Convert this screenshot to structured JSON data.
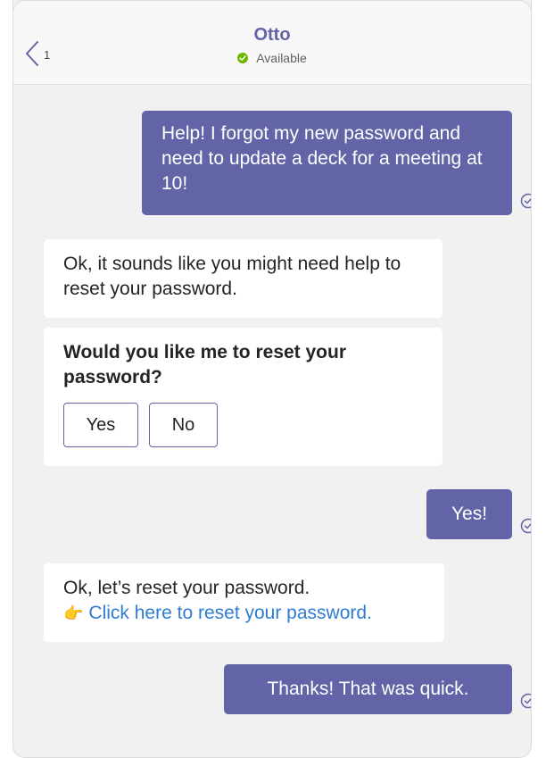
{
  "header": {
    "back_count": "1",
    "title": "Otto",
    "status": "Available"
  },
  "messages": {
    "m1": "Help! I forgot my new password and need to update a deck for a meeting at 10!",
    "m2": "Ok, it sounds like you might need help to reset your password.",
    "card": {
      "title": "Would you like me to reset your password?",
      "yes_label": "Yes",
      "no_label": "No"
    },
    "m3": "Yes!",
    "m4_text": "Ok, let’s reset your password.",
    "m4_link": "Click here to reset your password.",
    "m4_link_icon": "👉",
    "m5": "Thanks! That was quick."
  },
  "colors": {
    "accent": "#6264a7",
    "available": "#6bb700",
    "link": "#2e7cd1"
  },
  "icons": {
    "back": "chevron-left-icon",
    "status": "check-circle-icon",
    "read_receipt": "check-circle-outline-icon",
    "link": "pointing-hand-icon"
  }
}
